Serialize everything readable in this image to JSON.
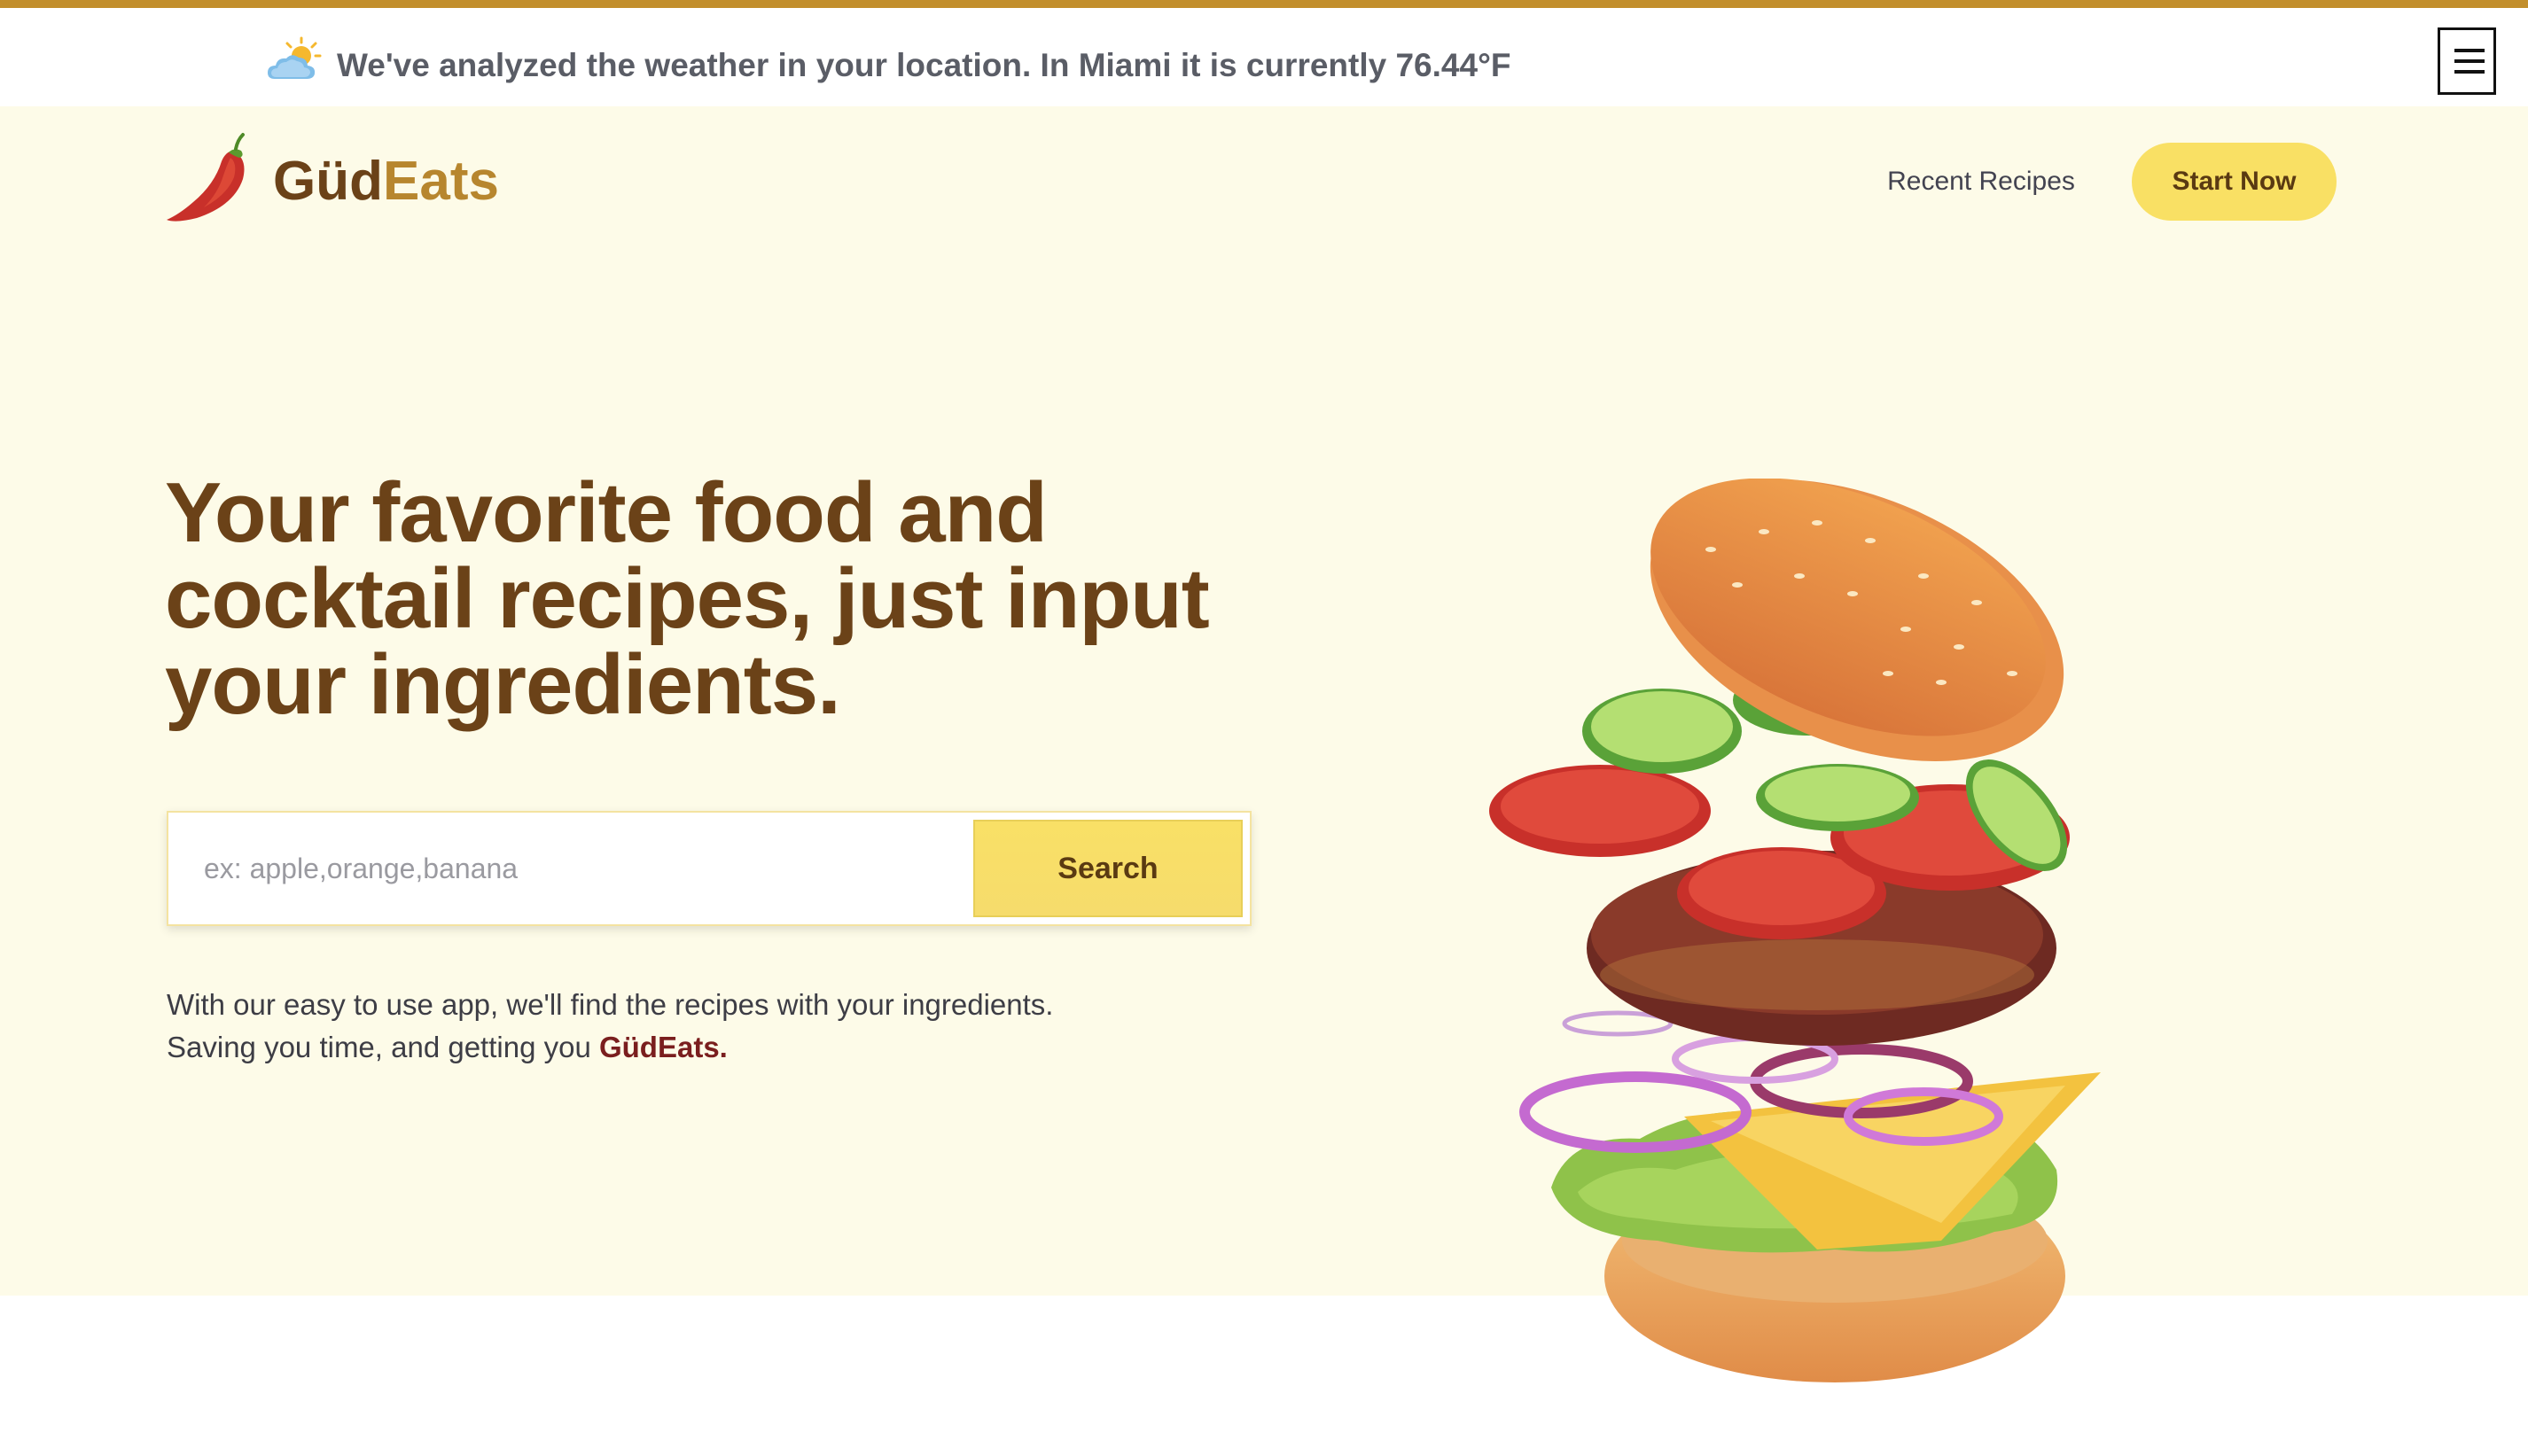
{
  "weather_bar": {
    "icon": "partly-sunny-icon",
    "message": "We've analyzed the weather in your location. In Miami it is currently 76.44°F"
  },
  "menu": {
    "icon": "hamburger-menu-icon"
  },
  "header": {
    "logo_icon": "chili-pepper-icon",
    "logo_part1": "Güd",
    "logo_part2": "Eats",
    "nav_recent": "Recent Recipes",
    "start_button": "Start Now"
  },
  "hero": {
    "headline": "Your favorite food and cocktail recipes, just input your ingredients.",
    "search": {
      "placeholder": "ex: apple,orange,banana",
      "value": "",
      "button": "Search"
    },
    "description_line1": "With our easy to use app, we'll find the recipes with your ingredients.",
    "description_line2_prefix": "Saving you time, and getting you ",
    "description_brand": "GüdEats."
  },
  "colors": {
    "accent_gold": "#c28e2c",
    "hero_background": "#fdfbe8",
    "brand_brown": "#6b4218",
    "button_yellow": "#f9e064",
    "brand_red": "#7a1e1e"
  }
}
